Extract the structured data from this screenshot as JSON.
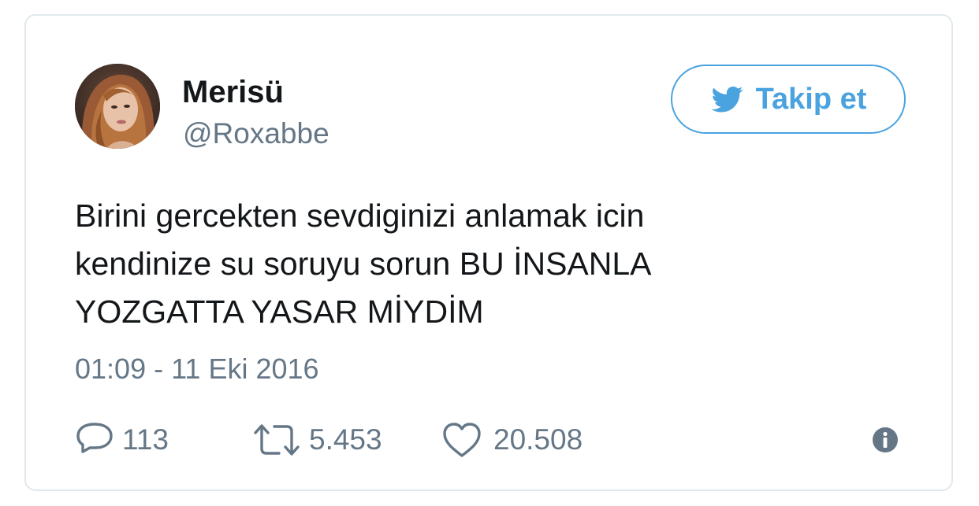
{
  "tweet": {
    "author": {
      "name": "Merisü",
      "handle": "@Roxabbe"
    },
    "follow_button": {
      "label": "Takip et",
      "icon": "twitter-bird-icon"
    },
    "text_lines": [
      "Birini gercekten sevdiginizi anlamak icin",
      "kendinize su soruyu sorun BU İNSANLA",
      "YOZGATTA YASAR MİYDİM"
    ],
    "timestamp": "01:09 - 11 Eki 2016",
    "actions": {
      "replies": {
        "count": "113",
        "icon": "reply-icon"
      },
      "retweets": {
        "count": "5.453",
        "icon": "retweet-icon"
      },
      "likes": {
        "count": "20.508",
        "icon": "heart-icon"
      },
      "info": {
        "icon": "info-icon"
      }
    }
  },
  "colors": {
    "accent": "#4aa3df",
    "text_primary": "#14171a",
    "text_secondary": "#657786",
    "border": "#e1e8ed"
  }
}
